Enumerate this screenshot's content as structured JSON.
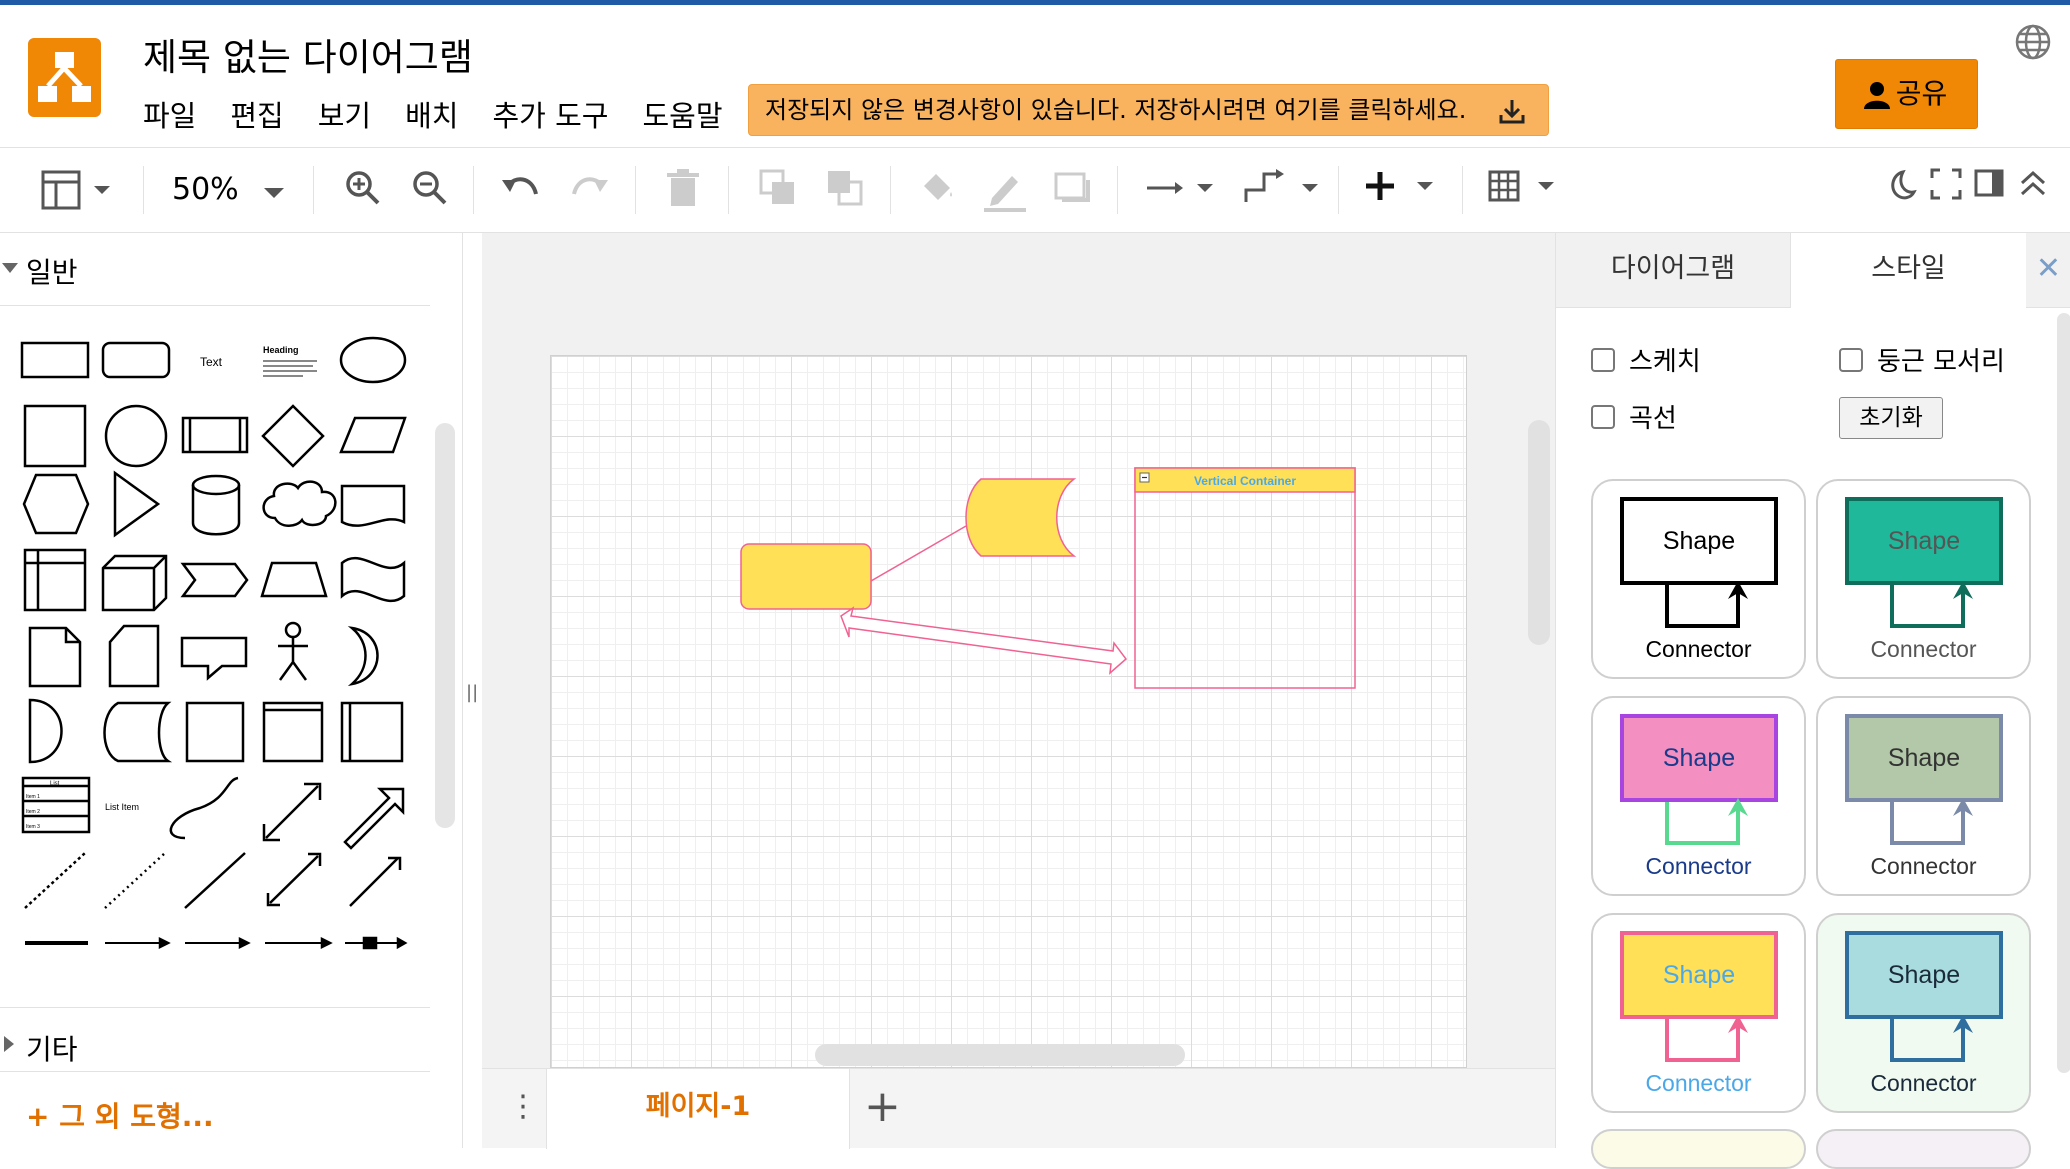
{
  "app": {
    "title": "제목 없는 다이어그램",
    "menu": [
      "파일",
      "편집",
      "보기",
      "배치",
      "추가 도구",
      "도움말"
    ],
    "unsaved_notice": "저장되지 않은 변경사항이 있습니다. 저장하시려면 여기를 클릭하세요.",
    "share_label": "공유",
    "colors": {
      "accent": "#f08705",
      "brand_line": "#1f5aa6",
      "notice_bg": "#f9b25e"
    }
  },
  "toolbar": {
    "zoom": "50%",
    "icons": [
      "format-panel-icon",
      "zoom-in-icon",
      "zoom-out-icon",
      "undo-icon",
      "redo-icon",
      "delete-icon",
      "to-front-icon",
      "to-back-icon",
      "fill-color-icon",
      "line-color-icon",
      "shadow-icon",
      "connection-icon",
      "waypoints-icon",
      "insert-icon",
      "table-icon",
      "dark-mode-icon",
      "fullscreen-icon",
      "format-toggle-icon",
      "collapse-icon"
    ]
  },
  "sidebar": {
    "section_general": "일반",
    "section_other": "기타",
    "more_shapes": "+ 그 외 도형...",
    "shape_text_label": "Text",
    "shape_heading_label": "Heading",
    "shape_list_label": "List",
    "shape_list_items": [
      "Item 1",
      "Item 2",
      "Item 3"
    ],
    "shape_list_item_label": "List Item"
  },
  "canvas": {
    "container_label": "Vertical Container",
    "shape_fill": "#ffe057",
    "shape_stroke": "#f06292"
  },
  "pages": {
    "tabs": [
      "페이지-1"
    ]
  },
  "format_panel": {
    "tabs": [
      "다이어그램",
      "스타일"
    ],
    "close": "✕",
    "options": {
      "sketch": "스케치",
      "rounded": "둥근 모서리",
      "curved": "곡선",
      "reset": "초기화"
    },
    "styles": [
      {
        "shape": "Shape",
        "connector": "Connector",
        "fill": "#ffffff",
        "stroke": "#000000",
        "font": "#000000",
        "conn": "#000000",
        "bg": "#ffffff"
      },
      {
        "shape": "Shape",
        "connector": "Connector",
        "fill": "#1fb89a",
        "stroke": "#0f6e5b",
        "font": "#555555",
        "conn": "#0f6e5b",
        "bg": "#ffffff"
      },
      {
        "shape": "Shape",
        "connector": "Connector",
        "fill": "#f48fc1",
        "stroke": "#a844e0",
        "font": "#1a3a8a",
        "conn": "#59d88f",
        "bg": "#ffffff"
      },
      {
        "shape": "Shape",
        "connector": "Connector",
        "fill": "#b2c8a8",
        "stroke": "#7a8aa8",
        "font": "#333333",
        "conn": "#7a8aa8",
        "bg": "#ffffff"
      },
      {
        "shape": "Shape",
        "connector": "Connector",
        "fill": "#ffe057",
        "stroke": "#f06292",
        "font": "#4aa8e8",
        "conn": "#f06292",
        "bg": "#ffffff"
      },
      {
        "shape": "Shape",
        "connector": "Connector",
        "fill": "#a8dcde",
        "stroke": "#2f6fa0",
        "font": "#1a2a3a",
        "conn": "#2f6fa0",
        "bg": "#f0faf0"
      }
    ]
  }
}
